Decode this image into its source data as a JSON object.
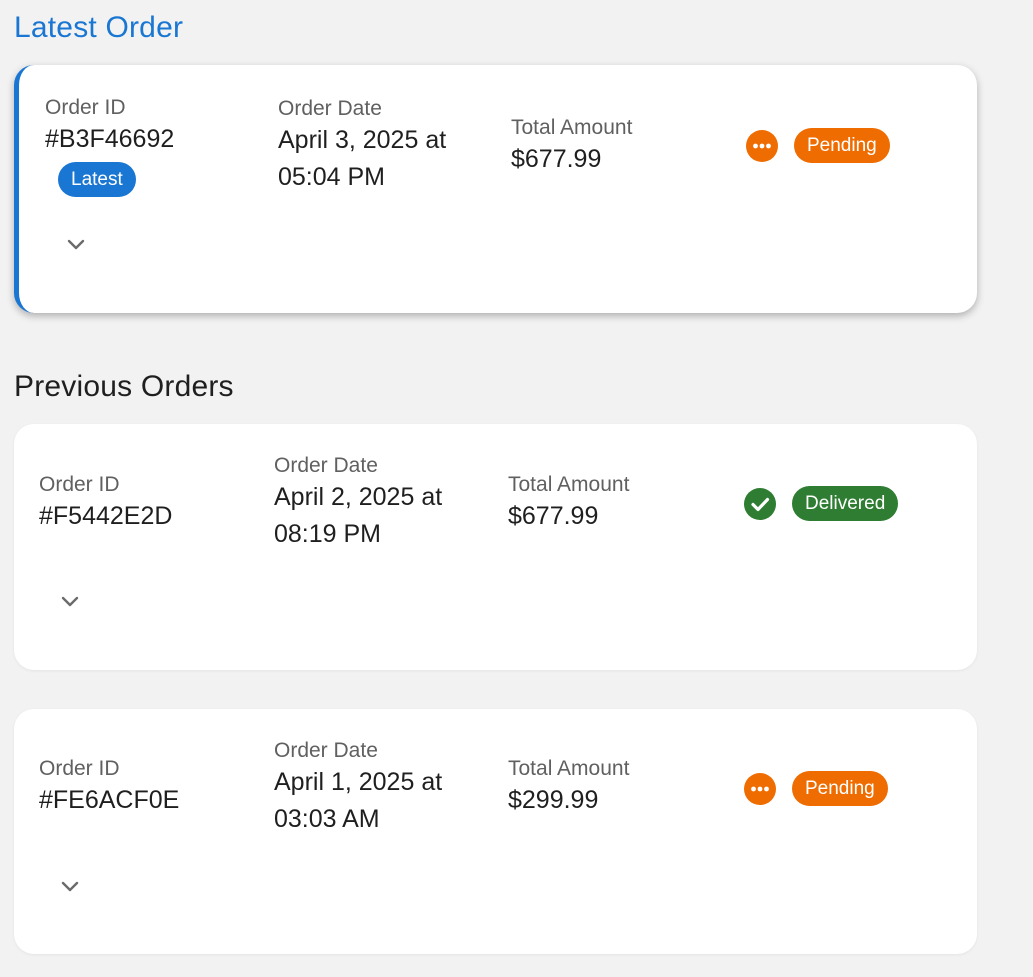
{
  "latest_section": {
    "title": "Latest Order"
  },
  "previous_section": {
    "title": "Previous Orders"
  },
  "labels": {
    "order_id": "Order ID",
    "order_date": "Order Date",
    "total_amount": "Total Amount"
  },
  "latest_order": {
    "id": "#B3F46692",
    "badge": "Latest",
    "date_line1": "April 3, 2025 at",
    "date_line2": "05:04 PM",
    "total": "$677.99",
    "status": "Pending",
    "status_icon": "more-horiz-icon"
  },
  "previous_orders": [
    {
      "id": "#F5442E2D",
      "date_line1": "April 2, 2025 at",
      "date_line2": "08:19 PM",
      "total": "$677.99",
      "status": "Delivered",
      "status_icon": "check-circle-icon"
    },
    {
      "id": "#FE6ACF0E",
      "date_line1": "April 1, 2025 at",
      "date_line2": "03:03 AM",
      "total": "$299.99",
      "status": "Pending",
      "status_icon": "more-horiz-icon"
    }
  ],
  "colors": {
    "accent": "#1976d2",
    "pending": "#ef6c00",
    "delivered": "#2e7d32",
    "background": "#f2f2f2"
  }
}
